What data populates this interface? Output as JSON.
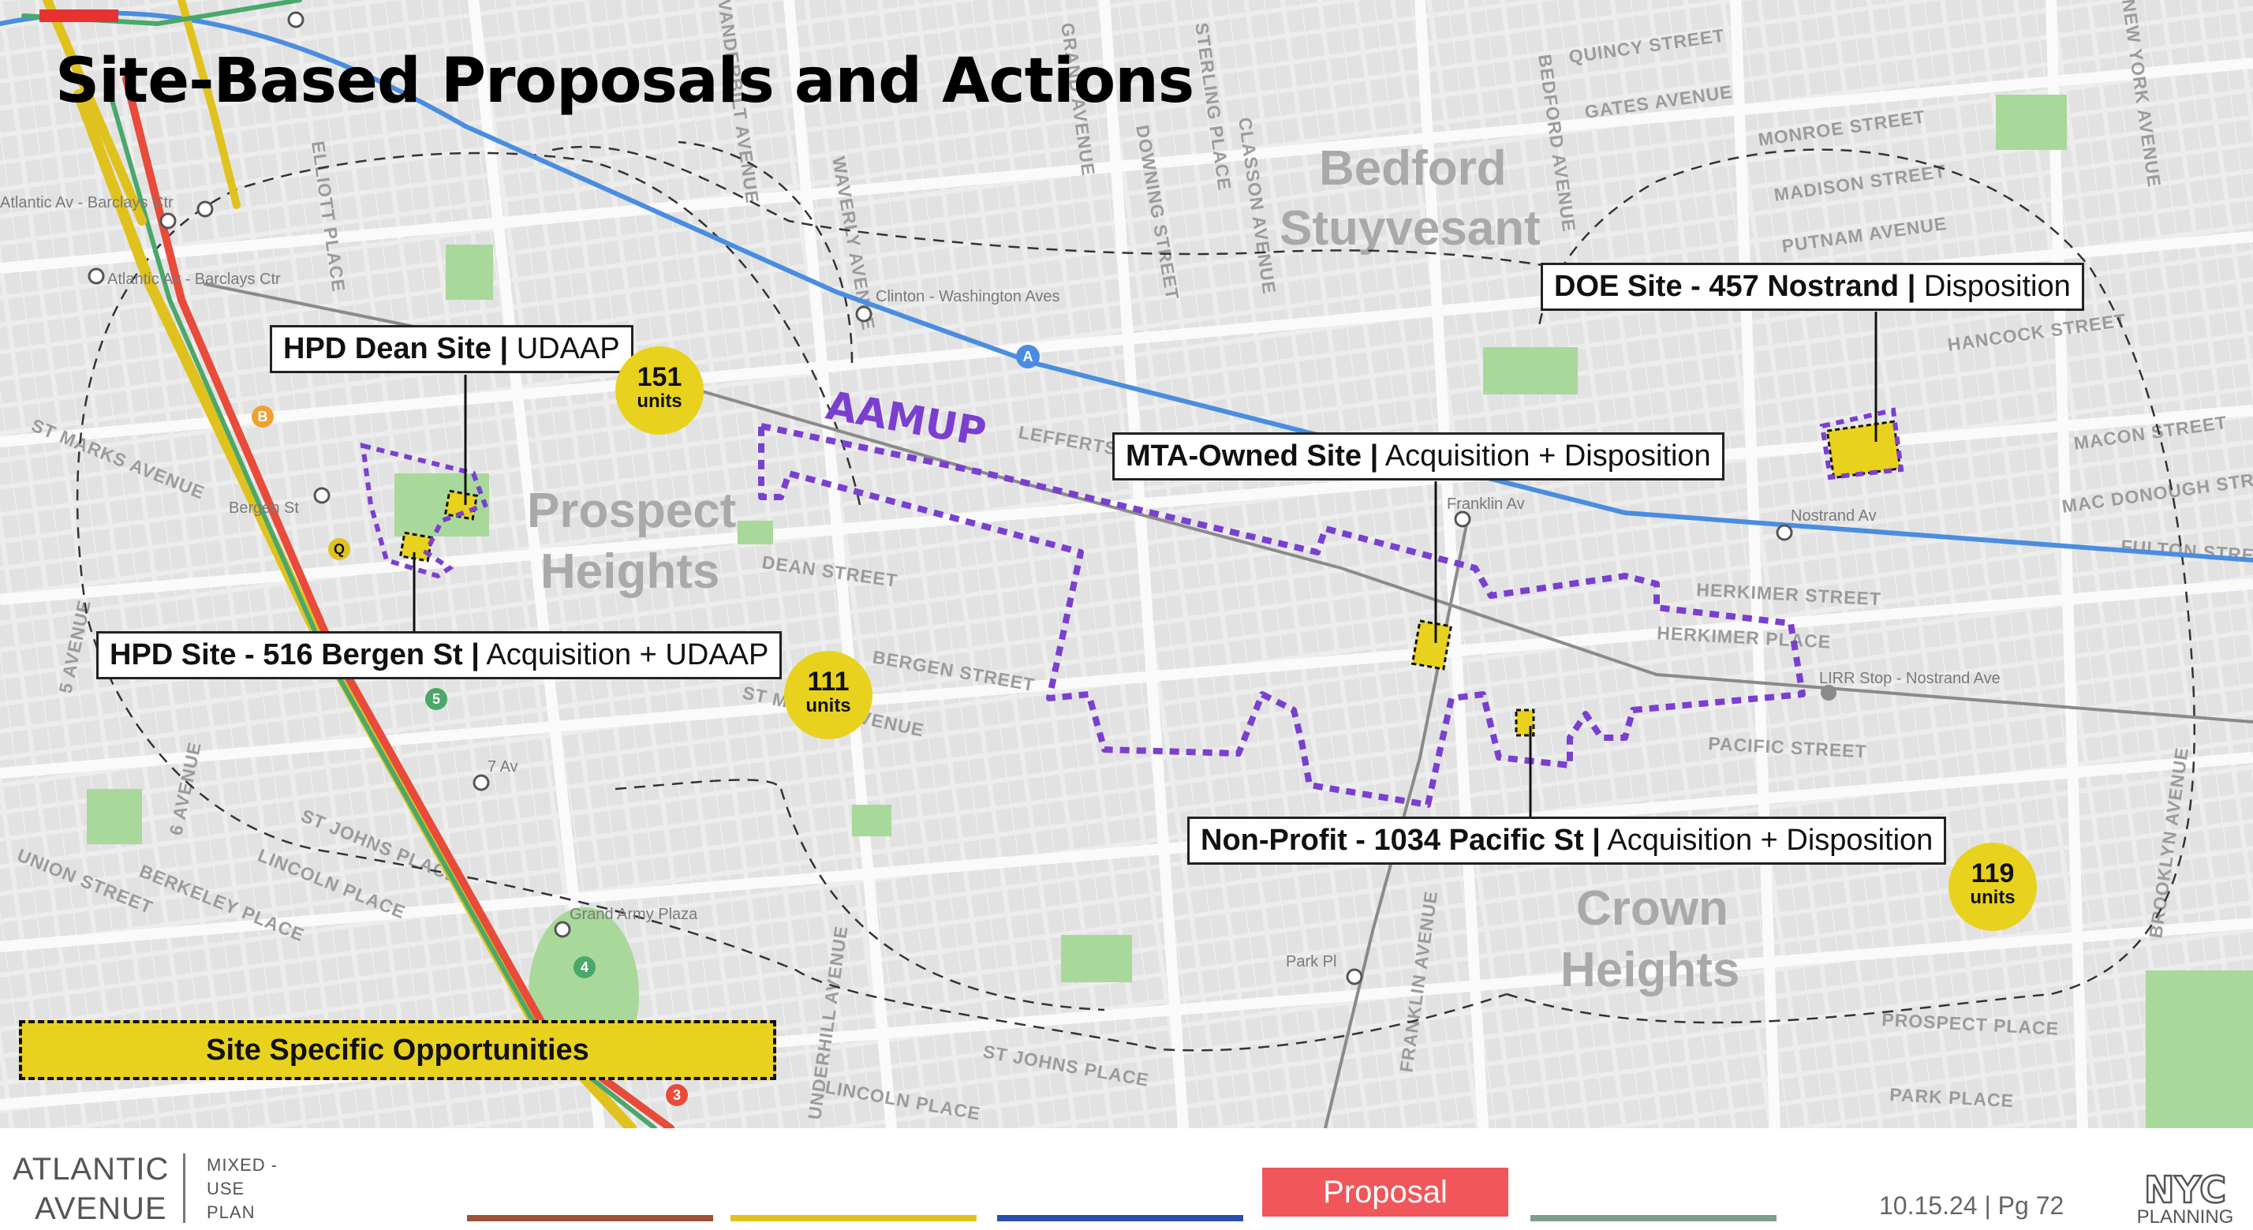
{
  "title": "Site-Based Proposals and Actions",
  "colors": {
    "accent_red": "#e8322f",
    "site_yellow": "#e8d21e",
    "aamup_purple": "#7b3fd0",
    "subway_blue": "#4a8de0",
    "proposal_red": "#f0565a"
  },
  "map": {
    "area_label": "AAMUP",
    "neighborhoods": [
      {
        "line1": "Bedford",
        "line2": "Stuyvesant"
      },
      {
        "line1": "Prospect",
        "line2": "Heights"
      },
      {
        "line1": "Crown",
        "line2": "Heights"
      }
    ],
    "streets": [
      "QUINCY STREET",
      "GATES AVENUE",
      "MONROE STREET",
      "MADISON STREET",
      "PUTNAM AVENUE",
      "HANCOCK STREET",
      "MACON STREET",
      "MAC DONOUGH STR",
      "FULTON STRE",
      "HERKIMER STREET",
      "HERKIMER PLACE",
      "PACIFIC STREET",
      "DEAN STREET",
      "BERGEN STREET",
      "ST MARKS AVENUE",
      "ST MARKS AVENUE",
      "ST JOHNS PLACE",
      "LINCOLN PLACE",
      "BERKELEY PLACE",
      "UNION STREET",
      "LEFFERTS",
      "PROSPECT PLACE",
      "PARK PLACE",
      "ST JOHNS PLACE",
      "LINCOLN PLACE",
      "WAVERLY AVENUE",
      "DOWNING STREET",
      "FRANKLIN AVENUE",
      "BEDFORD AVENUE",
      "BROOKLYN AVENUE",
      "UNDERHILL AVENUE",
      "ELLIOTT PLACE",
      "6 AVENUE",
      "5 AVENUE",
      "VANDERBILT AVENUE",
      "GRAND AVENUE",
      "STERLING PLACE",
      "CLASSON AVENUE",
      "NEW YORK AVENUE"
    ],
    "stations": [
      "Atlantic Av - Barclays Ctr",
      "Atlantic Av - Barclays Ctr",
      "Clinton - Washington Aves",
      "Bergen St",
      "7 Av",
      "Grand Army Plaza",
      "Franklin Av",
      "Nostrand Av",
      "LIRR Stop - Nostrand Ave",
      "Park Pl"
    ],
    "route_bullets": [
      "A",
      "B",
      "Q",
      "5",
      "4",
      "3"
    ]
  },
  "callouts": [
    {
      "name": "HPD Dean Site",
      "action": "UDAAP"
    },
    {
      "name": "HPD Site - 516 Bergen St",
      "action": "Acquisition + UDAAP"
    },
    {
      "name": "MTA-Owned Site",
      "action": "Acquisition + Disposition"
    },
    {
      "name": "DOE Site - 457 Nostrand",
      "action": "Disposition"
    },
    {
      "name": "Non-Profit - 1034 Pacific St",
      "action": "Acquisition + Disposition"
    }
  ],
  "units_badges": [
    {
      "value": "151",
      "label": "units"
    },
    {
      "value": "111",
      "label": "units"
    },
    {
      "value": "119",
      "label": "units"
    }
  ],
  "legend": {
    "label": "Site Specific Opportunities"
  },
  "footer": {
    "brand_line1": "ATLANTIC",
    "brand_line2": "AVENUE",
    "plan_line1": "MIXED -",
    "plan_line2": "USE",
    "plan_line3": "PLAN",
    "progress_colors": [
      "#a0513a",
      "#e0c21e",
      "#2b4fae",
      "#f0565a",
      "#7e9e8a"
    ],
    "active_step": "Proposal",
    "date": "10.15.24",
    "page_label": "| Pg",
    "page_number": "72",
    "logo_line1": "NYC",
    "logo_line2": "PLANNING"
  }
}
